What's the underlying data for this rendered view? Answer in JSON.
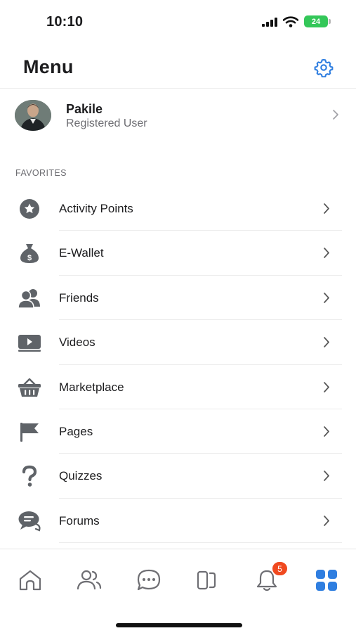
{
  "status_bar": {
    "time": "10:10",
    "battery": "24",
    "icons": [
      "signal-icon",
      "wifi-icon",
      "battery-icon"
    ]
  },
  "header": {
    "title": "Menu",
    "settings_icon": "gear-icon"
  },
  "profile": {
    "name": "Pakile",
    "role": "Registered User"
  },
  "favorites": {
    "label": "FAVORITES",
    "items": [
      {
        "label": "Activity Points",
        "icon": "star-badge-icon"
      },
      {
        "label": "E-Wallet",
        "icon": "money-bag-icon"
      },
      {
        "label": "Friends",
        "icon": "users-icon"
      },
      {
        "label": "Videos",
        "icon": "video-icon"
      },
      {
        "label": "Marketplace",
        "icon": "basket-icon"
      },
      {
        "label": "Pages",
        "icon": "flag-icon"
      },
      {
        "label": "Quizzes",
        "icon": "question-icon"
      },
      {
        "label": "Forums",
        "icon": "chat-bubbles-icon"
      }
    ]
  },
  "tab_bar": {
    "tabs": [
      "home-icon",
      "friends-icon",
      "messages-icon",
      "pages-icon",
      "notifications-icon",
      "menu-grid-icon"
    ],
    "notification_count": "5",
    "active_tab": "menu",
    "active_color": "#2f7ee0",
    "inactive_color": "#6e6e73"
  }
}
